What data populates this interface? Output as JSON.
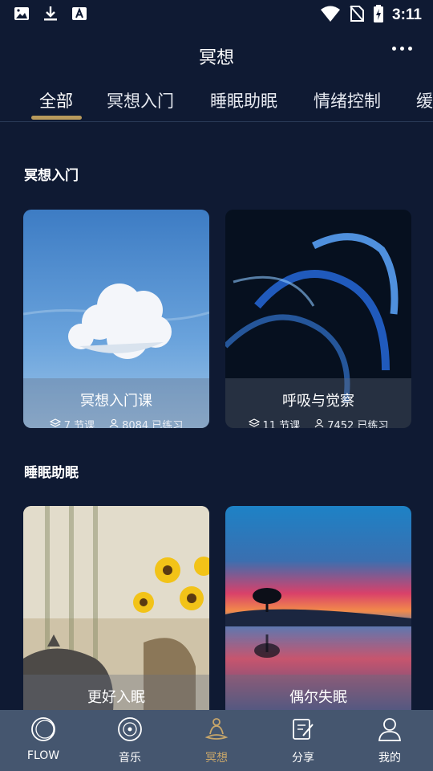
{
  "status": {
    "time": "3:11"
  },
  "header": {
    "title": "冥想"
  },
  "tabs": [
    {
      "label": "全部"
    },
    {
      "label": "冥想入门"
    },
    {
      "label": "睡眠助眠"
    },
    {
      "label": "情绪控制"
    },
    {
      "label": "缓"
    }
  ],
  "sections": [
    {
      "title": "冥想入门",
      "cards": [
        {
          "name": "冥想入门课",
          "lessons": "7 节课",
          "practiced": "8084 已练习"
        },
        {
          "name": "呼吸与觉察",
          "lessons": "11 节课",
          "practiced": "7452 已练习"
        }
      ]
    },
    {
      "title": "睡眠助眠",
      "cards": [
        {
          "name": "更好入眠"
        },
        {
          "name": "偶尔失眠"
        }
      ]
    }
  ],
  "nav": [
    {
      "label": "FLOW"
    },
    {
      "label": "音乐"
    },
    {
      "label": "冥想"
    },
    {
      "label": "分享"
    },
    {
      "label": "我的"
    }
  ],
  "colors": {
    "background": "#0f1a33",
    "accent": "#c8a66a",
    "nav_bg": "#45566f"
  }
}
